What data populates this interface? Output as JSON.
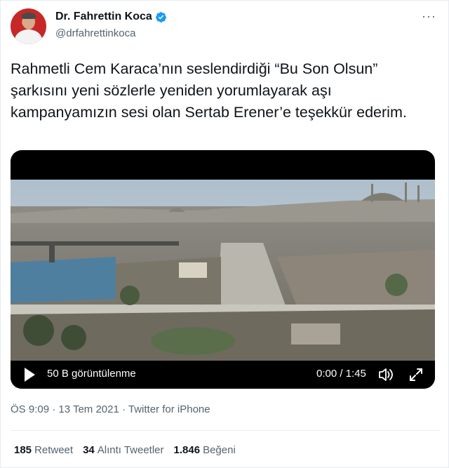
{
  "author": {
    "display_name": "Dr. Fahrettin Koca",
    "handle": "@drfahrettinkoca"
  },
  "menu": {
    "more_icon_text": "···"
  },
  "tweet": {
    "text": "Rahmetli Cem Karaca’nın seslendirdiği “Bu Son Olsun” şarkısını yeni sözlerle yeniden yorumlayarak aşı kampanyamızın sesi olan Sertab Erener’e teşekkür ederim."
  },
  "video": {
    "views": "50 B görüntülenme",
    "time": "0:00 / 1:45",
    "progress": 0
  },
  "meta": {
    "timestamp": "ÖS 9:09 · 13 Tem 2021 · Twitter for iPhone"
  },
  "stats": [
    {
      "count": "185",
      "label": "Retweet"
    },
    {
      "count": "34",
      "label": "Alıntı Tweetler"
    },
    {
      "count": "1.846",
      "label": "Beğeni"
    }
  ],
  "colors": {
    "verified": "#1d9bf0",
    "secondary_text": "#536471"
  },
  "icons": [
    "verified-badge-icon",
    "more-icon",
    "play-icon",
    "volume-icon",
    "fullscreen-icon"
  ]
}
